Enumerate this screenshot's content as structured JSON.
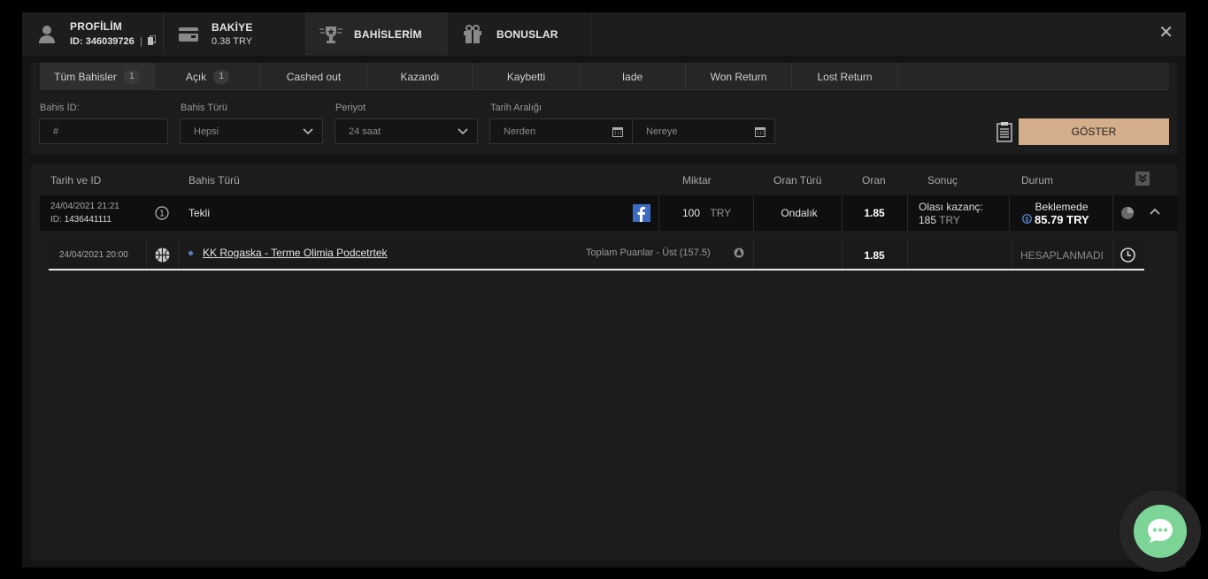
{
  "header": {
    "tabs": [
      {
        "title": "PROFİLİM",
        "sub": "ID: 346039726"
      },
      {
        "title": "BAKİYE",
        "sub": "0.38 TRY"
      },
      {
        "title": "BAHİSLERİM"
      },
      {
        "title": "BONUSLAR"
      }
    ]
  },
  "filters": {
    "subtabs": [
      {
        "label": "Tüm Bahisler",
        "count": "1"
      },
      {
        "label": "Açık",
        "count": "1"
      },
      {
        "label": "Cashed out"
      },
      {
        "label": "Kazandı"
      },
      {
        "label": "Kaybetti"
      },
      {
        "label": "Iade"
      },
      {
        "label": "Won Return"
      },
      {
        "label": "Lost Return"
      }
    ],
    "bet_id_label": "Bahis İD:",
    "bet_id_placeholder": "#",
    "bet_type_label": "Bahis Türü",
    "bet_type_value": "Hepsi",
    "period_label": "Periyot",
    "period_value": "24 saat",
    "date_range_label": "Tarih Aralığı",
    "from_placeholder": "Nerden",
    "to_placeholder": "Nereye",
    "show_button": "GÖSTER"
  },
  "table": {
    "headers": [
      "Tarih ve ID",
      "Bahis Türü",
      "Miktar",
      "Oran Türü",
      "Oran",
      "Sonuç",
      "Durum"
    ],
    "bet": {
      "datetime": "24/04/2021 21:21",
      "id_label": "ID:",
      "id": "1436441111",
      "type": "Tekli",
      "amount": "100",
      "currency": "TRY",
      "odds_type": "Ondalık",
      "odds": "1.85",
      "result_label": "Olası kazanç:",
      "result_amount": "185",
      "result_currency": "TRY",
      "status": "Beklemede",
      "cashout": "85.79 TRY"
    },
    "event": {
      "datetime": "24/04/2021 20:00",
      "name": "KK Rogaska - Terme Olimia Podcetrtek",
      "market": "Toplam Puanlar - Üst (157.5)",
      "odds": "1.85",
      "status": "HESAPLANMADI"
    }
  }
}
